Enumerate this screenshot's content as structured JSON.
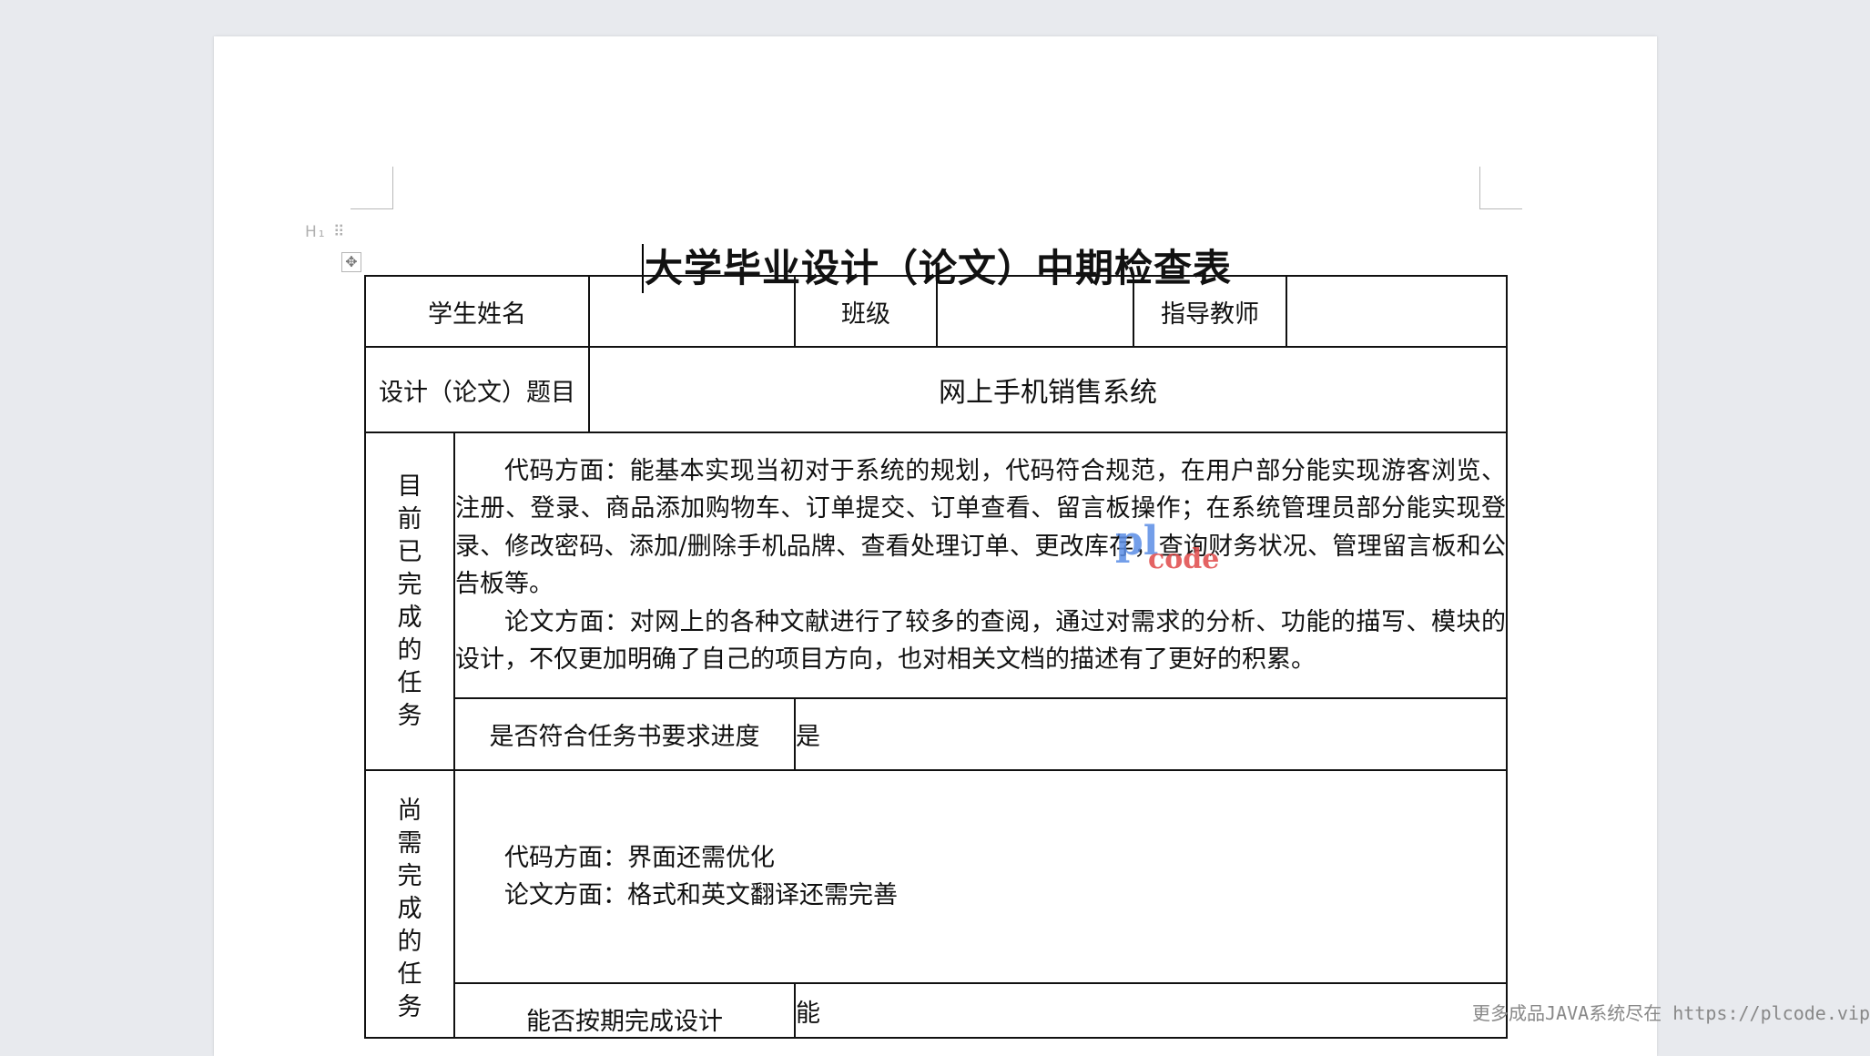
{
  "document": {
    "heading_marker": "H₁ ⠿",
    "move_handle_icon": "✥",
    "title": "大学毕业设计（论文）中期检查表"
  },
  "table": {
    "student_name_label": "学生姓名",
    "student_name_value": "",
    "class_label": "班级",
    "class_value": "",
    "advisor_label": "指导教师",
    "advisor_value": "",
    "topic_label": "设计（论文）题目",
    "topic_value": "网上手机销售系统",
    "completed_section": {
      "label_chars": [
        "目",
        "前",
        "已",
        "完",
        "成",
        "的",
        "任",
        "务"
      ],
      "paragraphs": [
        "代码方面：能基本实现当初对于系统的规划，代码符合规范，在用户部分能实现游客浏览、注册、登录、商品添加购物车、订单提交、订单查看、留言板操作；在系统管理员部分能实现登录、修改密码、添加/删除手机品牌、查看处理订单、更改库存，查询财务状况、管理留言板和公告板等。",
        "论文方面：对网上的各种文献进行了较多的查阅，通过对需求的分析、功能的描写、模块的设计，不仅更加明确了自己的项目方向，也对相关文档的描述有了更好的积累。"
      ],
      "progress_label": "是否符合任务书要求进度",
      "progress_value": "是"
    },
    "remaining_section": {
      "label_chars": [
        "尚",
        "需",
        "完",
        "成",
        "的",
        "任",
        "务"
      ],
      "paragraphs": [
        "代码方面：界面还需优化",
        "论文方面：格式和英文翻译还需完善"
      ],
      "ontime_label": "能否按期完成设计",
      "ontime_value": "能"
    }
  },
  "watermark": {
    "line1": "pl",
    "line2": "code"
  },
  "footer_note": "更多成品JAVA系统尽在 https://plcode.vip"
}
